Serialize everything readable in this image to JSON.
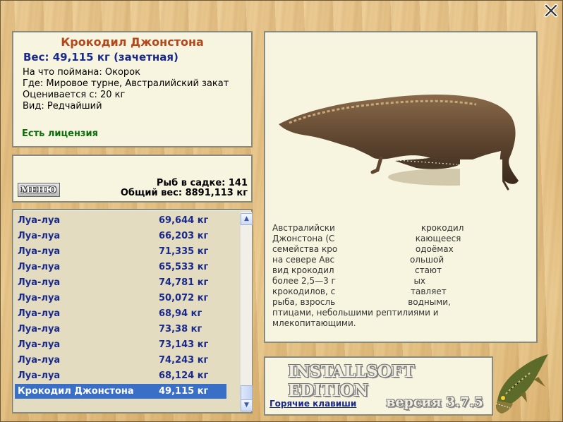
{
  "window": {
    "close_icon": "close-x-icon"
  },
  "fish_info": {
    "title": "Крокодил Джонстона",
    "weight": "Вес: 49,115 кг (зачетная)",
    "caught_on": "На что поймана: Окорок",
    "where": "Где: Мировое турне, Австралийский закат",
    "valued_from": "Оценивается с: 20 кг",
    "kind": "Вид: Редчайший",
    "license": "Есть лицензия"
  },
  "stats": {
    "menu_label": "МЕНЮ",
    "fish_count": "Рыб в садке: 141",
    "total_weight": "Общий вес: 8891,113 кг"
  },
  "catch_list": [
    {
      "name": "Луа-луа",
      "weight": "69,644 кг"
    },
    {
      "name": "Луа-луа",
      "weight": "66,203 кг"
    },
    {
      "name": "Луа-луа",
      "weight": "71,335 кг"
    },
    {
      "name": "Луа-луа",
      "weight": "65,533 кг"
    },
    {
      "name": "Луа-луа",
      "weight": "74,781 кг"
    },
    {
      "name": "Луа-луа",
      "weight": "50,072 кг"
    },
    {
      "name": "Луа-луа",
      "weight": "68,94 кг"
    },
    {
      "name": "Луа-луа",
      "weight": "73,38 кг"
    },
    {
      "name": "Луа-луа",
      "weight": "73,143 кг"
    },
    {
      "name": "Луа-луа",
      "weight": "74,243 кг"
    },
    {
      "name": "Луа-луа",
      "weight": "68,124 кг"
    },
    {
      "name": "Крокодил Джонстона",
      "weight": "49,115 кг",
      "selected": true
    }
  ],
  "scrollbar": {
    "up_icon": "scroll-up-arrow-icon",
    "down_icon": "scroll-down-arrow-icon"
  },
  "description": {
    "image": "crocodile-image",
    "lines": [
      "Австралийски                                крокодил",
      "Джонстона (С                              кающееся",
      "семейства кро                             одоёмах",
      "на севере Авс                            ольшой",
      "вид крокодил                              стают",
      "более 2,5—3 г                             ых",
      "крокодилов, с                            тавляет",
      "рыба, взросль                           водными,",
      "птицами, небольшими рептилиями и",
      "млекопитающими."
    ]
  },
  "bottom": {
    "logo": "INSTALLSOFT EDITION",
    "version": "версия 3.7.5",
    "hotkeys": "Горячие клавиши",
    "pike_image": "pike-fish-icon"
  },
  "colors": {
    "title": "#b4471b",
    "weight": "#1a2a8c",
    "license": "#0b6e0b",
    "selection": "#3a6fc8"
  }
}
